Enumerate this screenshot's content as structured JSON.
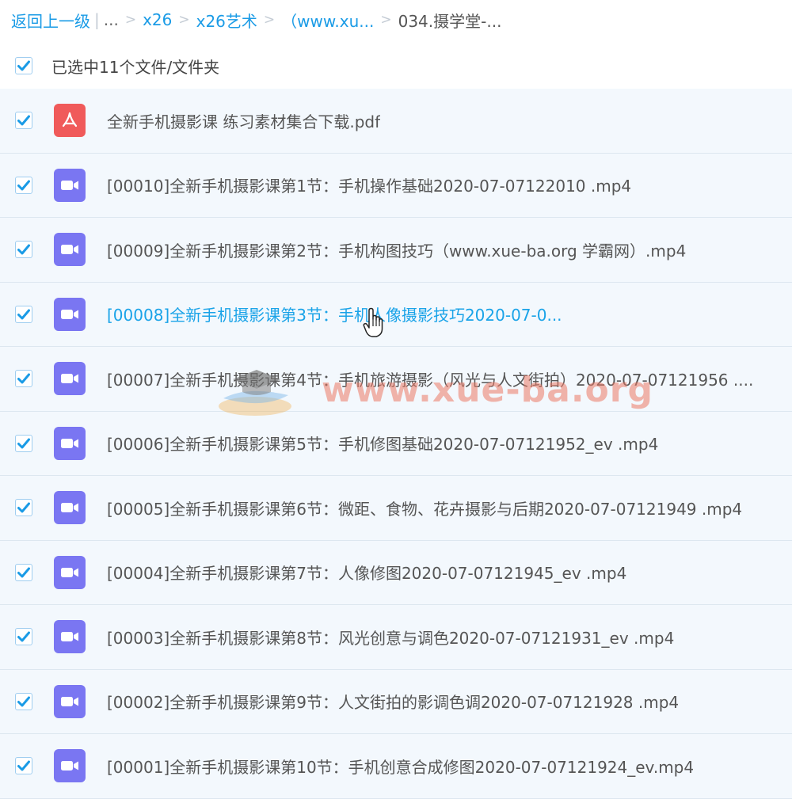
{
  "breadcrumb": {
    "back": "返回上一级",
    "separator_bar": "|",
    "ellipsis": "...",
    "separator": ">",
    "items": [
      "x26",
      "x26艺术",
      "（www.xu...",
      "034.摄学堂-..."
    ]
  },
  "selection": {
    "label": "已选中11个文件/文件夹",
    "checked": true
  },
  "files": [
    {
      "name": "全新手机摄影课 练习素材集合下载.pdf",
      "type": "pdf-icon",
      "checked": true
    },
    {
      "name": "[00010]全新手机摄影课第1节：手机操作基础2020-07-07122010 .mp4",
      "type": "video-icon",
      "checked": true
    },
    {
      "name": "[00009]全新手机摄影课第2节：手机构图技巧（www.xue-ba.org 学霸网）.mp4",
      "type": "video-icon",
      "checked": true
    },
    {
      "name": "[00008]全新手机摄影课第3节：手机人像摄影技巧2020-07-0...",
      "type": "video-icon",
      "checked": true
    },
    {
      "name": "[00007]全新手机摄影课第4节：手机旅游摄影（风光与人文街拍）2020-07-07121956 ....",
      "type": "video-icon",
      "checked": true
    },
    {
      "name": "[00006]全新手机摄影课第5节：手机修图基础2020-07-07121952_ev .mp4",
      "type": "video-icon",
      "checked": true
    },
    {
      "name": "[00005]全新手机摄影课第6节：微距、食物、花卉摄影与后期2020-07-07121949 .mp4",
      "type": "video-icon",
      "checked": true
    },
    {
      "name": "[00004]全新手机摄影课第7节：人像修图2020-07-07121945_ev .mp4",
      "type": "video-icon",
      "checked": true
    },
    {
      "name": "[00003]全新手机摄影课第8节：风光创意与调色2020-07-07121931_ev .mp4",
      "type": "video-icon",
      "checked": true
    },
    {
      "name": "[00002]全新手机摄影课第9节：人文街拍的影调色调2020-07-07121928 .mp4",
      "type": "video-icon",
      "checked": true
    },
    {
      "name": "[00001]全新手机摄影课第10节：手机创意合成修图2020-07-07121924_ev.mp4",
      "type": "video-icon",
      "checked": true
    }
  ],
  "watermark": {
    "text": "www.xue-ba.org"
  },
  "colors": {
    "link": "#1a9be6",
    "hover_text": "#1aa3e8",
    "row_bg": "#f3f8fd",
    "pdf_icon": "#f05a5a",
    "video_icon": "#7a76f2",
    "check": "#1a9be6"
  }
}
